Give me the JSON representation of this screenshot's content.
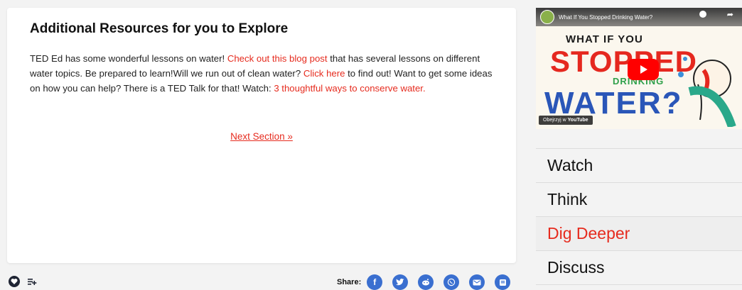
{
  "resources": {
    "heading": "Additional Resources for you to Explore",
    "p1": "TED Ed has some wonderful lessons on water! ",
    "link1": "Check out this blog post",
    "p2": " that has several lessons on different water topics. Be prepared to learn!Will we run out of clean water? ",
    "link2": "Click here",
    "p3": " to find out! Want to get some ideas on how you can help? There is a TED Talk for that! Watch: ",
    "link3": "3 thoughtful ways to conserve water.",
    "next_label": "Next Section »"
  },
  "share": {
    "label": "Share:",
    "icons": [
      "facebook-icon",
      "twitter-icon",
      "reddit-icon",
      "whatsapp-icon",
      "email-icon",
      "print-icon"
    ]
  },
  "video": {
    "title": "What If You Stopped Drinking Water?",
    "art_line1": "WHAT IF YOU",
    "art_line2": "STOPPED",
    "art_line3": "DRINKING",
    "art_line4": "WATER?",
    "watch_on": "Obejrzyj w",
    "youtube": "YouTube"
  },
  "sidenav": {
    "items": [
      {
        "label": "Watch"
      },
      {
        "label": "Think"
      },
      {
        "label": "Dig Deeper"
      },
      {
        "label": "Discuss"
      }
    ],
    "active_index": 2
  },
  "colors": {
    "accent": "#e62b1e",
    "share_blue": "#3a6fd0"
  }
}
